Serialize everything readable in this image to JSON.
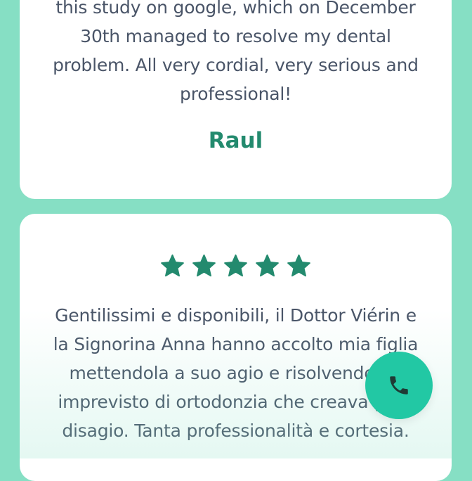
{
  "reviews": [
    {
      "text": "this study on google, which on December 30th managed to resolve my dental problem. All very cordial, very serious and professional!",
      "author": "Raul"
    },
    {
      "stars": 5,
      "text": "Gentilissimi e disponibili, il Dottor Viérin e la Signorina Anna hanno accolto mia figlia mettendola a suo agio e risolvendo un imprevisto di ortodonzia che creava gran disagio. Tanta professionalità e cortesia."
    }
  ],
  "colors": {
    "background": "#86dfc4",
    "card": "#ffffff",
    "accent": "#238a6e",
    "text": "#4a5568",
    "call_button": "#22c8a4"
  },
  "icons": {
    "rating": "star-icon",
    "call": "phone-icon"
  }
}
